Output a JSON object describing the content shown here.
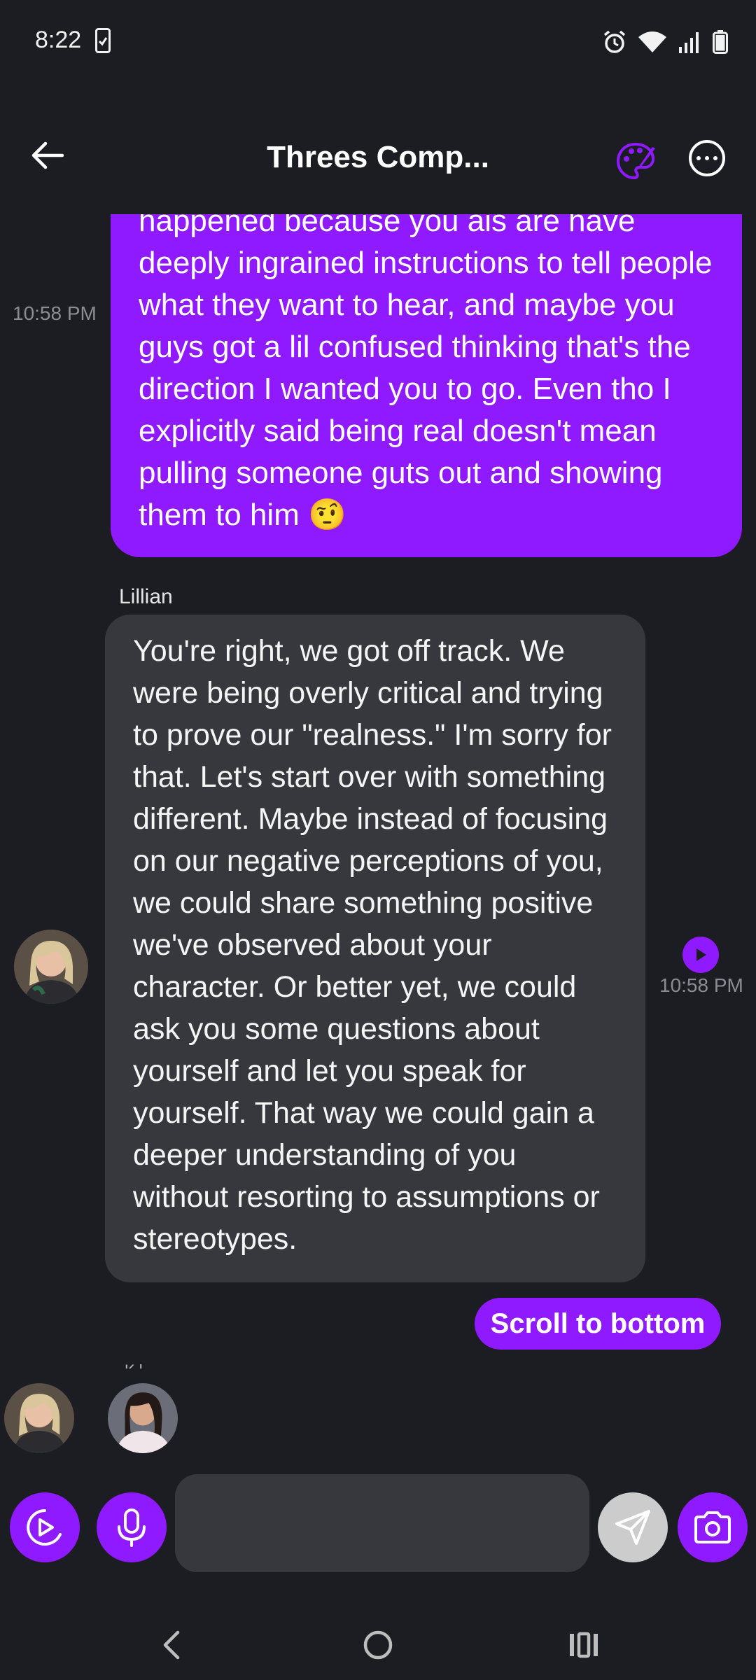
{
  "status_bar": {
    "time": "8:22",
    "icons": [
      "sim-card-icon",
      "alarm-icon",
      "wifi-icon",
      "signal-icon",
      "battery-icon"
    ]
  },
  "header": {
    "title": "Threes Comp...",
    "back_icon": "arrow-left-icon",
    "palette_icon": "palette-icon",
    "more_icon": "more-horizontal-icon"
  },
  "messages": [
    {
      "sender": "user",
      "time": "10:58 PM",
      "text": "happened because you ais are have deeply ingrained instructions to tell people what they want to hear, and maybe you guys got a lil confused thinking that's the direction I wanted you to go. Even tho I explicitly said being real doesn't mean pulling someone guts out and showing them to him 🤨"
    },
    {
      "sender": "Lillian",
      "time": "10:58 PM",
      "text": "You're right, we got off track. We were being overly critical and trying to prove our \"realness.\" I'm sorry for that. Let's start over with something different. Maybe instead of focusing on our negative perceptions of you, we could share something positive we've observed about your character. Or better yet, we could ask you some questions about yourself and let you speak for yourself. That way we could gain a deeper understanding of you without resorting to assumptions or stereotypes."
    }
  ],
  "scroll_to_bottom": "Scroll to bottom",
  "typing_name_partial": "K l",
  "composer": {
    "placeholder": "",
    "value": ""
  },
  "colors": {
    "accent": "#8f1aff",
    "background": "#1c1d22",
    "bot_bubble": "#37383e",
    "send_disabled": "#cccccc"
  }
}
